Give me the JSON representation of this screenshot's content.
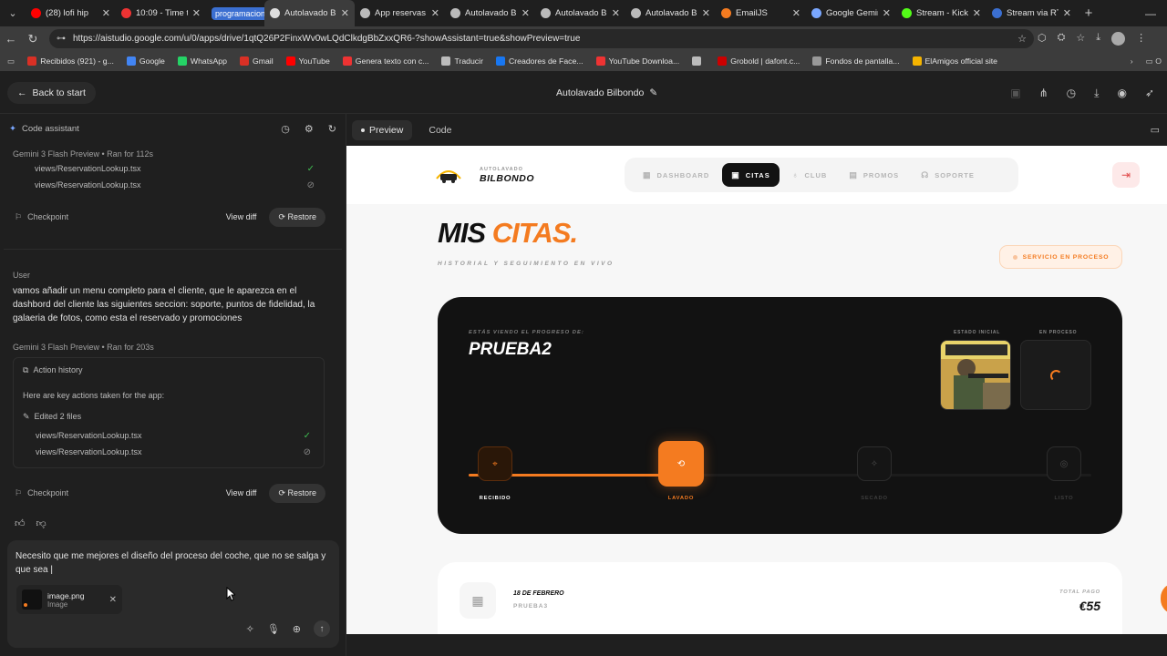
{
  "browser": {
    "tabs": [
      {
        "title": "(28) lofi hip",
        "fav": "#ff0000"
      },
      {
        "title": "10:09 - Time to",
        "fav": "#e33"
      },
      {
        "group": "programacion"
      },
      {
        "title": "Autolavado Bilb",
        "fav": "#ddd",
        "active": true
      },
      {
        "title": "App reservas a",
        "fav": "#bbb"
      },
      {
        "title": "Autolavado Bilb",
        "fav": "#bbb"
      },
      {
        "title": "Autolavado Bilb",
        "fav": "#bbb"
      },
      {
        "title": "Autolavado Bilb",
        "fav": "#bbb"
      },
      {
        "title": "EmailJS",
        "fav": "#f47b20"
      },
      {
        "title": "Google Gemini",
        "fav": "#7aa7ff"
      },
      {
        "title": "Stream - Kick D",
        "fav": "#53fc18"
      },
      {
        "title": "Stream via RTM",
        "fav": "#3b6fd1"
      }
    ],
    "url": "https://aistudio.google.com/u/0/apps/drive/1qtQ26P2FinxWv0wLQdClkdgBbZxxQR6-?showAssistant=true&showPreview=true",
    "bookmarks": [
      {
        "label": "Recibidos (921) - g...",
        "fav": "#d93025"
      },
      {
        "label": "Google",
        "fav": "#4285f4"
      },
      {
        "label": "WhatsApp",
        "fav": "#25d366"
      },
      {
        "label": "Gmail",
        "fav": "#d93025"
      },
      {
        "label": "YouTube",
        "fav": "#ff0000"
      },
      {
        "label": "Genera texto con c...",
        "fav": "#e33"
      },
      {
        "label": "Traducir",
        "fav": "#bbb"
      },
      {
        "label": "Creadores de Face...",
        "fav": "#1877f2"
      },
      {
        "label": "YouTube Downloa...",
        "fav": "#e33"
      },
      {
        "label": "",
        "fav": "#bbb"
      },
      {
        "label": "Grobold | dafont.c...",
        "fav": "#c00"
      },
      {
        "label": "Fondos de pantalla...",
        "fav": "#999"
      },
      {
        "label": "ElAmigos official site",
        "fav": "#f5b400"
      }
    ]
  },
  "app": {
    "back_label": "Back to start",
    "project_title": "Autolavado Bilbondo"
  },
  "assistant": {
    "header": "Code assistant",
    "meta1": "Gemini 3 Flash Preview  •  Ran for 112s",
    "files1": [
      "views/ReservationLookup.tsx",
      "views/ReservationLookup.tsx"
    ],
    "checkpoint": "Checkpoint",
    "view_diff": "View diff",
    "restore": "Restore",
    "user_label": "User",
    "user_message": "vamos añadir un menu completo para el cliente, que le aparezca en el dashbord del cliente las siguientes seccion: soporte, puntos de fidelidad, la galaeria de fotos, como esta el reservado y promociones",
    "meta2": "Gemini 3 Flash Preview  •  Ran for 203s",
    "action_history": "Action history",
    "key_actions": "Here are key actions taken for the app:",
    "edited": "Edited 2 files",
    "files2": [
      "views/ReservationLookup.tsx",
      "views/ReservationLookup.tsx"
    ],
    "composer_text": "Necesito que me mejores el diseño del proceso del coche, que no se salga y que sea |",
    "attachment_name": "image.png",
    "attachment_type": "Image"
  },
  "preview_tabs": {
    "preview": "Preview",
    "code": "Code"
  },
  "site": {
    "logo_top": "AUTOLAVADO",
    "logo_name": "BILBONDO",
    "nav": [
      "DASHBOARD",
      "CITAS",
      "CLUB",
      "PROMOS",
      "SOPORTE"
    ],
    "nav_active": "CITAS",
    "heading_main": "MIS",
    "heading_accent": "CITAS.",
    "subheading": "HISTORIAL Y SEGUIMIENTO EN VIVO",
    "status_badge": "SERVICIO EN PROCESO",
    "card": {
      "viewing_label": "ESTÁS VIENDO EL PROGRESO DE:",
      "client_name": "PRUEBA2",
      "initial_state": "ESTADO INICIAL",
      "in_process": "EN PROCESO",
      "steps": [
        "RECIBIDO",
        "LAVADO",
        "SECADO",
        "LISTO"
      ],
      "current_step": 2,
      "progress_fraction": 0.31
    },
    "appointment": {
      "date": "18 DE FEBRERO",
      "client": "PRUEBA3",
      "total_label": "TOTAL PAGO",
      "total": "€55"
    }
  },
  "colors": {
    "accent": "#f47b20",
    "dark_card": "#121212"
  }
}
